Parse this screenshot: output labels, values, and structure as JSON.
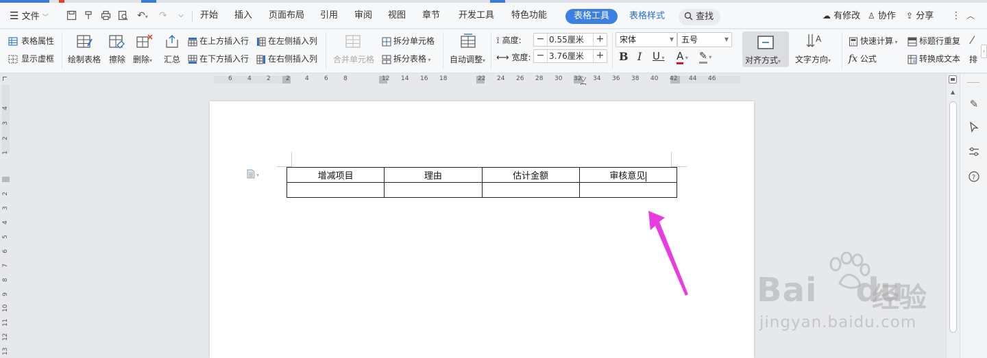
{
  "menubar": {
    "file_label": "文件",
    "tabs": [
      {
        "label": "开始"
      },
      {
        "label": "插入"
      },
      {
        "label": "页面布局"
      },
      {
        "label": "引用"
      },
      {
        "label": "审阅"
      },
      {
        "label": "视图"
      },
      {
        "label": "章节"
      },
      {
        "label": "开发工具"
      },
      {
        "label": "特色功能"
      }
    ],
    "active_tab": "表格工具",
    "secondary_tab": "表格样式",
    "search_label": "查找",
    "right": {
      "modified": "有修改",
      "collab": "协作",
      "share": "分享"
    }
  },
  "ribbon": {
    "table_props": "表格属性",
    "show_gridlines": "显示虚框",
    "draw_table": "绘制表格",
    "erase": "擦除",
    "delete": "删除",
    "summarize": "汇总",
    "insert_row_above": "在上方插入行",
    "insert_row_below": "在下方插入行",
    "insert_col_left": "在左侧插入列",
    "insert_col_right": "在右侧插入列",
    "merge_cells": "合并单元格",
    "split_cells": "拆分单元格",
    "split_table": "拆分表格",
    "auto_fit": "自动调整",
    "height_label": "高度:",
    "height_value": "0.55厘米",
    "width_label": "宽度:",
    "width_value": "3.76厘米",
    "font_name": "宋体",
    "font_size": "五号",
    "align": "对齐方式",
    "text_direction": "文字方向",
    "quick_calc": "快速计算",
    "formula": "公式",
    "repeat_header": "标题行重复",
    "convert_text": "转换成文本",
    "sort_partial": "排"
  },
  "ruler": {
    "h_numbers": [
      "6",
      "4",
      "2",
      "2",
      "4",
      "6",
      "8",
      "12",
      "14",
      "16",
      "18",
      "22",
      "24",
      "26",
      "28",
      "30",
      "32",
      "34",
      "36",
      "38",
      "40",
      "42",
      "44",
      "46"
    ],
    "v_numbers": [
      "4",
      "3",
      "2",
      "1",
      "2",
      "3",
      "4",
      "5",
      "6",
      "7",
      "8",
      "9",
      "10",
      "11",
      "12",
      "13"
    ]
  },
  "document": {
    "table": {
      "rows": [
        [
          "增减项目",
          "理由",
          "估计金额",
          "审核意见"
        ],
        [
          "",
          "",
          "",
          ""
        ]
      ]
    }
  },
  "watermark": {
    "brand": "Bai",
    "brand_tail": "du",
    "cn": "经验",
    "url": "jingyan.baidu.com"
  },
  "colors": {
    "accent": "#3c80e6",
    "arrow": "#e83ce0"
  }
}
